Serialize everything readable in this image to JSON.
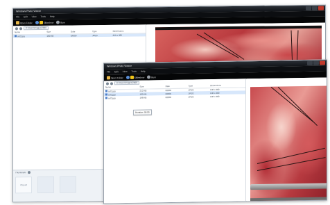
{
  "back_window": {
    "title": "Windows Photo Viewer",
    "menu": [
      "File",
      "Edit",
      "View",
      "Tools",
      "Help"
    ],
    "toolbar": {
      "open_label": "Open Folder",
      "slideshow_label": "Slideshow",
      "burn_label": "Burn"
    },
    "path": "C:\\Users\\Images\\2009",
    "table": {
      "headers": [
        "Name",
        "Size",
        "Date",
        "Type",
        "Dimensions"
      ],
      "rows": [
        [
          "cut2.jpg",
          "180 KB",
          "6/8/09",
          "JPEG",
          "640 x 480"
        ]
      ]
    },
    "bottom_panel": {
      "title": "Thumbnails",
      "thumb_label": "Clip art"
    }
  },
  "front_window": {
    "title": "Windows Photo Viewer",
    "menu": [
      "File",
      "Edit",
      "View",
      "Tools",
      "Help"
    ],
    "toolbar": {
      "open_label": "Open Folder",
      "slideshow_label": "Slideshow",
      "burn_label": "Burn"
    },
    "path": "C:\\Users\\Images\\2009",
    "table": {
      "headers": [
        "Name",
        "Size",
        "Date",
        "Type",
        "Dimensions"
      ],
      "rows": [
        [
          "cut1.jpg",
          "212 KB",
          "6/8/09",
          "JPEG",
          "640 x 480"
        ],
        [
          "cut2.jpg",
          "180 KB",
          "6/8/09",
          "JPEG",
          "640 x 480"
        ],
        [
          "cut3.jpg",
          "198 KB",
          "6/8/09",
          "JPEG",
          "640 x 480"
        ]
      ]
    },
    "tooltip": "Duration: 00:00"
  },
  "colors": {
    "titlebar": "#111418",
    "toolbar": "#050607",
    "selection": "#d7e7fb",
    "tissue": "#c84a4e"
  }
}
